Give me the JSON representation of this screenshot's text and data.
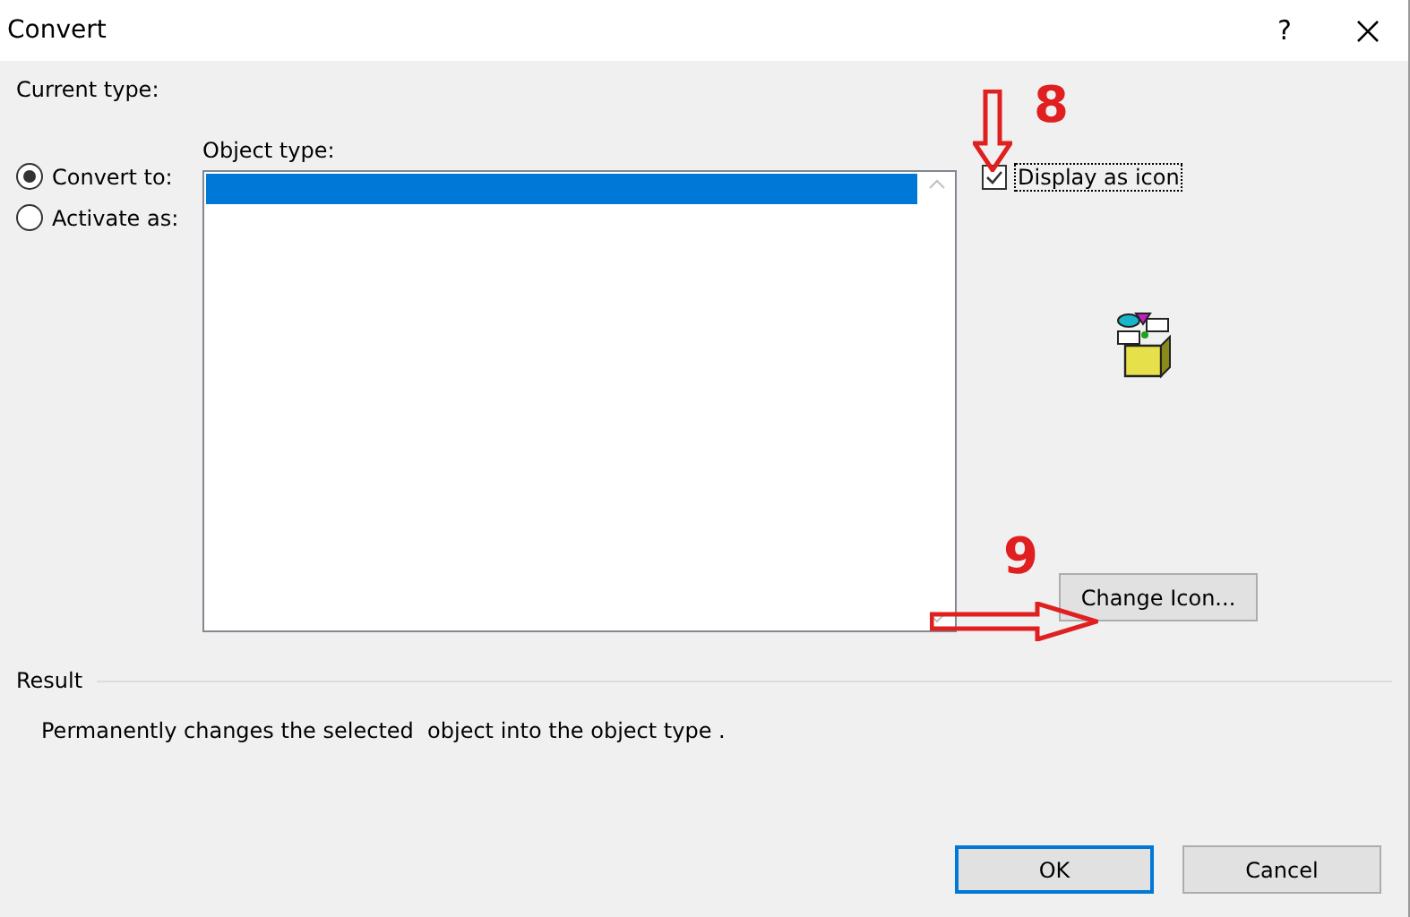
{
  "window": {
    "title": "Convert",
    "help": "?"
  },
  "current_type": {
    "label": "Current type:"
  },
  "options": [
    {
      "label": "Convert to:",
      "selected": true
    },
    {
      "label": "Activate as:",
      "selected": false
    }
  ],
  "object_type": {
    "label": "Object type:",
    "highlighted_row": true
  },
  "display_as_icon": {
    "label": "Display as icon",
    "checked": true
  },
  "change_icon_button": "Change Icon...",
  "result": {
    "label": "Result",
    "text": "Permanently changes the selected  object into the object type ."
  },
  "buttons": [
    {
      "label": "OK",
      "default": true
    },
    {
      "label": "Cancel",
      "default": false
    }
  ],
  "annotations": [
    {
      "label": "8",
      "kind": "down"
    },
    {
      "label": "9",
      "kind": "right"
    }
  ]
}
